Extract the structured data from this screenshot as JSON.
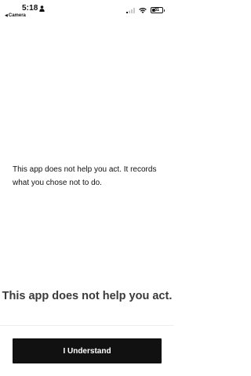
{
  "status_bar": {
    "time": "5:18",
    "back_label": "Camera",
    "back_icon": "chevron-left-icon",
    "battery_level": "31",
    "icons": [
      "person-icon",
      "signal-icon",
      "wifi-icon",
      "battery-icon"
    ]
  },
  "main": {
    "message": "This app does not help you act. It records what you chose not to do.",
    "headline": "This app does not help you act."
  },
  "actions": {
    "understand_label": "I Understand"
  },
  "colors": {
    "background": "#ffffff",
    "button_background": "#111111",
    "button_text": "#ffffff",
    "headline_text": "#3a3a3a"
  }
}
